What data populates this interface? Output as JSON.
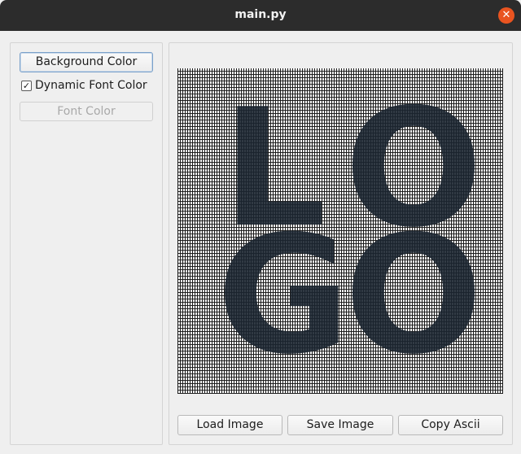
{
  "window": {
    "title": "main.py",
    "close_glyph": "✕"
  },
  "left_panel": {
    "background_color_button": "Background Color",
    "dynamic_font_color": {
      "label": "Dynamic Font Color",
      "checked": true,
      "glyph": "✓"
    },
    "font_color_button": "Font Color"
  },
  "right_panel": {
    "load_image_button": "Load Image",
    "save_image_button": "Save Image",
    "copy_ascii_button": "Copy Ascii"
  },
  "preview": {
    "logo_letters": [
      "L",
      "O",
      "G",
      "O"
    ],
    "logo_color": "#1b2530",
    "font_color": "#202020",
    "background_color": "#ffffff"
  },
  "colors": {
    "titlebar": "#2c2c2c",
    "close_button": "#e95420",
    "window_bg": "#efefef",
    "focus_border": "#7aa0c9"
  }
}
